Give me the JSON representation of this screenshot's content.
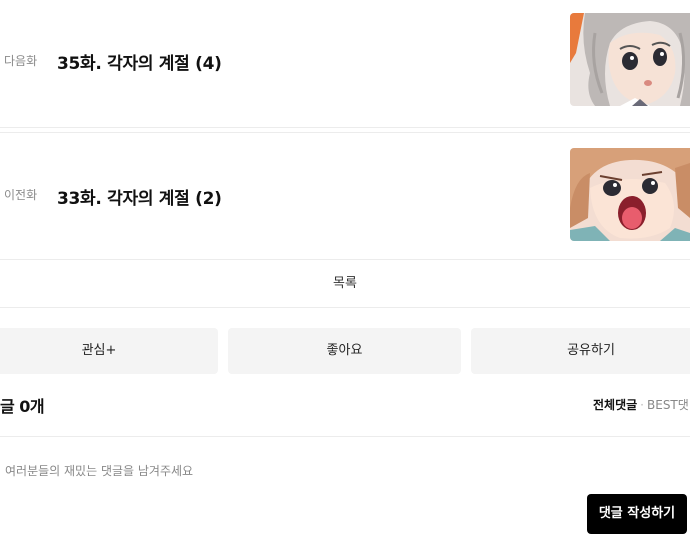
{
  "episodes": {
    "next": {
      "direction_label": "다음화",
      "title": "35화. 각자의 계절 (4)"
    },
    "prev": {
      "direction_label": "이전화",
      "title": "33화. 각자의 계절 (2)"
    }
  },
  "list_label": "목록",
  "actions": {
    "interest": "관심+",
    "like": "좋아요",
    "share": "공유하기"
  },
  "comments": {
    "count_label": "글 0개",
    "sort_all": "전체댓글",
    "sort_separator": "·",
    "sort_best": "BEST댓",
    "placeholder": "여러분들의 재밌는 댓글을 남겨주세요",
    "write_button": "댓글 작성하기"
  },
  "colors": {
    "accent_button": "#000000",
    "action_bg": "#f4f4f4",
    "divider": "#ececec"
  }
}
